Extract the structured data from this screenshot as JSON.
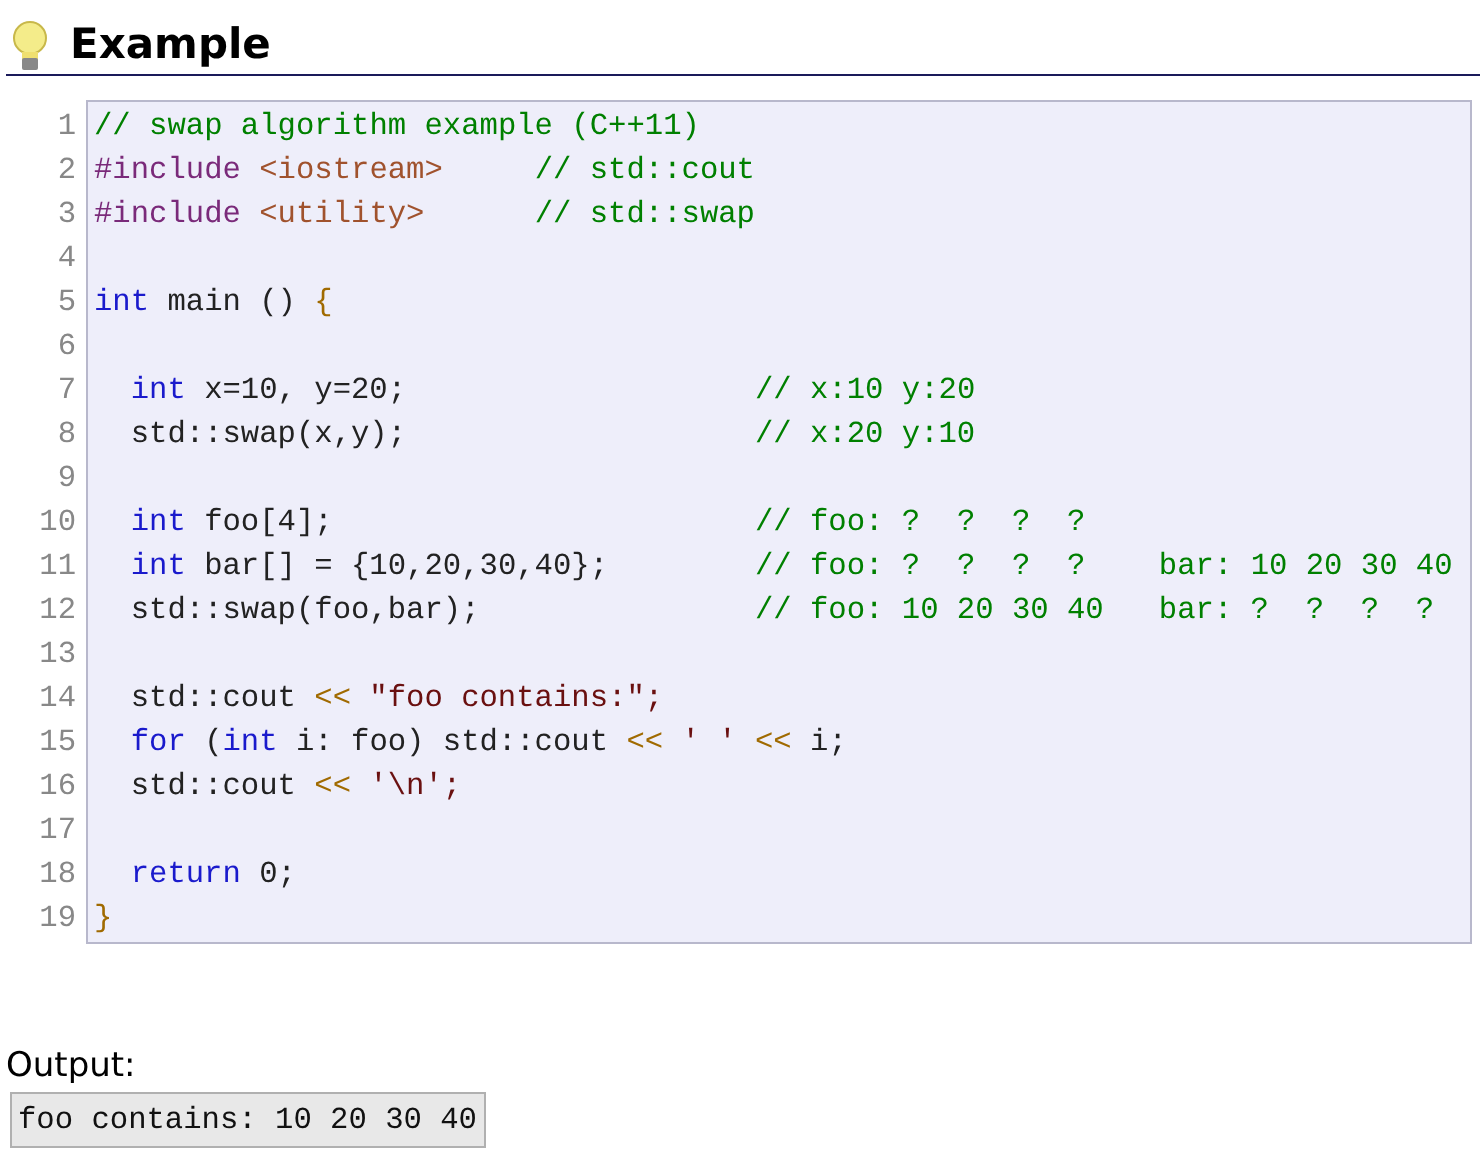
{
  "heading": "Example",
  "code": {
    "lines": [
      {
        "number": "1",
        "tokens": [
          {
            "kind": "comment",
            "text": "// swap algorithm example (C++11)"
          }
        ]
      },
      {
        "number": "2",
        "tokens": [
          {
            "kind": "preproc",
            "text": "#include "
          },
          {
            "kind": "header",
            "text": "<iostream>     "
          },
          {
            "kind": "comment",
            "text": "// std::cout"
          }
        ]
      },
      {
        "number": "3",
        "tokens": [
          {
            "kind": "preproc",
            "text": "#include "
          },
          {
            "kind": "header",
            "text": "<utility>      "
          },
          {
            "kind": "comment",
            "text": "// std::swap"
          }
        ]
      },
      {
        "number": "4"
      },
      {
        "number": "5",
        "tokens": [
          {
            "kind": "keyword",
            "text": "int"
          },
          {
            "kind": "plain",
            "text": " main () "
          },
          {
            "kind": "punct",
            "text": "{"
          }
        ]
      },
      {
        "number": "6"
      },
      {
        "number": "7",
        "indent": true,
        "tokens": [
          {
            "kind": "keyword",
            "text": "int"
          },
          {
            "kind": "plain",
            "text": " x=10, y=20;                   "
          },
          {
            "kind": "comment",
            "text": "// x:10 y:20"
          }
        ]
      },
      {
        "number": "8",
        "indent": true,
        "tokens": [
          {
            "kind": "plain",
            "text": "std::swap(x,y);                   "
          },
          {
            "kind": "comment",
            "text": "// x:20 y:10"
          }
        ]
      },
      {
        "number": "9"
      },
      {
        "number": "10",
        "indent": true,
        "tokens": [
          {
            "kind": "keyword",
            "text": "int"
          },
          {
            "kind": "plain",
            "text": " foo[4];                       "
          },
          {
            "kind": "comment",
            "text": "// foo: ?  ?  ?  ?"
          }
        ]
      },
      {
        "number": "11",
        "indent": true,
        "tokens": [
          {
            "kind": "keyword",
            "text": "int"
          },
          {
            "kind": "plain",
            "text": " bar[] = {10,20,30,40};        "
          },
          {
            "kind": "comment",
            "text": "// foo: ?  ?  ?  ?    bar: 10 20 30 40"
          }
        ]
      },
      {
        "number": "12",
        "indent": true,
        "tokens": [
          {
            "kind": "plain",
            "text": "std::swap(foo,bar);               "
          },
          {
            "kind": "comment",
            "text": "// foo: 10 20 30 40   bar: ?  ?  ?  ?"
          }
        ]
      },
      {
        "number": "13"
      },
      {
        "number": "14",
        "indent": true,
        "tokens": [
          {
            "kind": "plain",
            "text": "std::cout "
          },
          {
            "kind": "punct",
            "text": "<<"
          },
          {
            "kind": "string",
            "text": " \"foo contains:\";"
          }
        ]
      },
      {
        "number": "15",
        "indent": true,
        "tokens": [
          {
            "kind": "keyword",
            "text": "for"
          },
          {
            "kind": "plain",
            "text": " ("
          },
          {
            "kind": "keyword",
            "text": "int"
          },
          {
            "kind": "plain",
            "text": " i: foo) std::cout "
          },
          {
            "kind": "punct",
            "text": "<<"
          },
          {
            "kind": "string",
            "text": " ' ' "
          },
          {
            "kind": "punct",
            "text": "<<"
          },
          {
            "kind": "plain",
            "text": " i;"
          }
        ]
      },
      {
        "number": "16",
        "indent": true,
        "tokens": [
          {
            "kind": "plain",
            "text": "std::cout "
          },
          {
            "kind": "punct",
            "text": "<<"
          },
          {
            "kind": "string",
            "text": " '\\n';"
          }
        ]
      },
      {
        "number": "17"
      },
      {
        "number": "18",
        "indent": true,
        "tokens": [
          {
            "kind": "keyword",
            "text": "return"
          },
          {
            "kind": "plain",
            "text": " 0;"
          }
        ]
      },
      {
        "number": "19",
        "tokens": [
          {
            "kind": "punct",
            "text": "}"
          }
        ]
      }
    ]
  },
  "output": {
    "label": "Output:",
    "text": "foo contains: 10 20 30 40"
  }
}
